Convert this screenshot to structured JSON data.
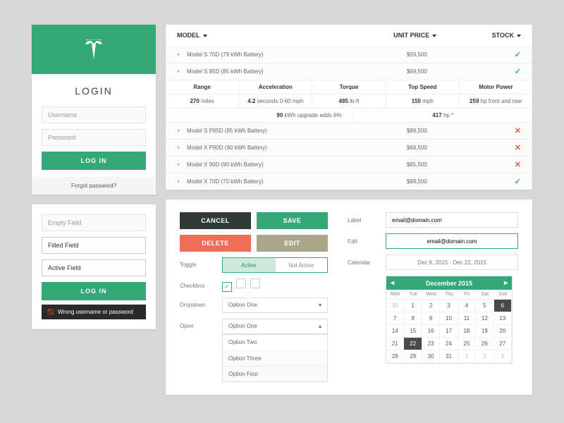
{
  "login": {
    "title": "LOGIN",
    "username_ph": "Username",
    "password_ph": "Password",
    "submit": "LOG IN",
    "forgot": "Forgot password?"
  },
  "login2": {
    "empty_ph": "Empty Field",
    "filled_val": "Filled Field",
    "active_val": "Active Field",
    "submit": "LOG IN",
    "error": "Wrong username or password"
  },
  "table": {
    "cols": {
      "model": "MODEL",
      "price": "UNIT PRICE",
      "stock": "STOCK"
    },
    "rows": [
      {
        "name": "Model S 70D (79 kWh Battery)",
        "price": "$59,500",
        "stock": true
      },
      {
        "name": "Model S 85D (85 kWh Battery)",
        "price": "$69,500",
        "stock": true
      },
      {
        "name": "Model S P85D (85 kWh Battery)",
        "price": "$89,500",
        "stock": false
      },
      {
        "name": "Model X P90D (90 kWh Battery)",
        "price": "$69,500",
        "stock": false
      },
      {
        "name": "Model X 90D (90 kWh Battery)",
        "price": "$85,500",
        "stock": false
      },
      {
        "name": "Model X 70D (70 kWh Battery)",
        "price": "$99,500",
        "stock": true
      }
    ],
    "detail_cols": [
      "Range",
      "Acceleration",
      "Torque",
      "Top Speed",
      "Motor Power"
    ],
    "detail_row": {
      "range_v": "270",
      "range_u": "miles",
      "accel_v": "4.2",
      "accel_u": "seconds 0-60 mph",
      "torque_v": "485",
      "torque_u": "lb-ft",
      "top_v": "155",
      "top_u": "mph",
      "power_v": "259",
      "power_u": "hp front and rear"
    },
    "upgrade_label": "kWh upgrade adds 6%",
    "upgrade_kwh": "90",
    "upgrade_power": "417",
    "upgrade_power_u": "hp *"
  },
  "form": {
    "buttons": {
      "cancel": "CANCEL",
      "save": "SAVE",
      "delete": "DELETE",
      "edit": "EDIT"
    },
    "toggle_label": "Toggle",
    "toggle": {
      "active": "Active",
      "inactive": "Not Active"
    },
    "checkbox_label": "Checkbox",
    "dropdown_label": "Dropdown",
    "open_label": "Open",
    "dropdown_selected": "Option One",
    "options": [
      "Option One",
      "Option Two",
      "Option Three",
      "Option Four"
    ],
    "label_label": "Label",
    "label_val": "email@domain.com",
    "edit_label": "Edit",
    "edit_val": "email@domain.com",
    "calendar_label": "Calendar",
    "range_val": "Dec 6, 2015 - Dec 22, 2015"
  },
  "calendar": {
    "title": "December 2015",
    "dow": [
      "Mon",
      "Tue",
      "Wed",
      "Thu",
      "Fri",
      "Sat",
      "Sun"
    ],
    "weeks": [
      [
        {
          "d": "30",
          "m": 1
        },
        {
          "d": "1"
        },
        {
          "d": "2"
        },
        {
          "d": "3"
        },
        {
          "d": "4"
        },
        {
          "d": "5"
        },
        {
          "d": "6",
          "s": 1
        }
      ],
      [
        {
          "d": "7"
        },
        {
          "d": "8"
        },
        {
          "d": "9"
        },
        {
          "d": "10"
        },
        {
          "d": "11"
        },
        {
          "d": "12"
        },
        {
          "d": "13"
        }
      ],
      [
        {
          "d": "14"
        },
        {
          "d": "15"
        },
        {
          "d": "16"
        },
        {
          "d": "17"
        },
        {
          "d": "18"
        },
        {
          "d": "19"
        },
        {
          "d": "20"
        }
      ],
      [
        {
          "d": "21"
        },
        {
          "d": "22",
          "s": 1
        },
        {
          "d": "23"
        },
        {
          "d": "24"
        },
        {
          "d": "25"
        },
        {
          "d": "26"
        },
        {
          "d": "27"
        }
      ],
      [
        {
          "d": "28"
        },
        {
          "d": "29"
        },
        {
          "d": "30"
        },
        {
          "d": "31"
        },
        {
          "d": "1",
          "m": 1
        },
        {
          "d": "2",
          "m": 1
        },
        {
          "d": "3",
          "m": 1
        }
      ]
    ]
  }
}
